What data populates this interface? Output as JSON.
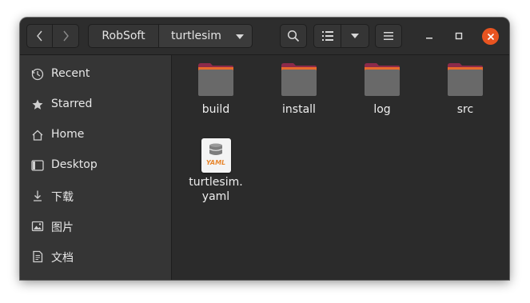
{
  "headerbar": {
    "back_icon": "chevron-left-icon",
    "forward_icon": "chevron-right-icon",
    "path": [
      "RobSoft",
      "turtlesim"
    ],
    "path_menu_icon": "triangle-down-icon",
    "search_icon": "search-icon",
    "view_icon": "list-view-icon",
    "view_menu_icon": "triangle-down-icon",
    "menu_icon": "hamburger-menu-icon",
    "close_color": "#e95420"
  },
  "sidebar": {
    "items": [
      {
        "label": "Recent",
        "icon": "clock-icon"
      },
      {
        "label": "Starred",
        "icon": "star-icon"
      },
      {
        "label": "Home",
        "icon": "home-icon"
      },
      {
        "label": "Desktop",
        "icon": "desktop-icon"
      },
      {
        "label": "下载",
        "icon": "download-icon"
      },
      {
        "label": "图片",
        "icon": "pictures-icon"
      },
      {
        "label": "文档",
        "icon": "documents-icon"
      }
    ]
  },
  "files": [
    {
      "name": "build",
      "type": "folder"
    },
    {
      "name": "install",
      "type": "folder"
    },
    {
      "name": "log",
      "type": "folder"
    },
    {
      "name": "src",
      "type": "folder"
    },
    {
      "name_line1": "turtlesim.",
      "name_line2": "yaml",
      "type": "yaml",
      "badge": "YAML"
    }
  ],
  "colors": {
    "folder_body": "#696969",
    "folder_tab": "#8c2a4a",
    "folder_top": "#e66a2c",
    "accent": "#e95420"
  }
}
